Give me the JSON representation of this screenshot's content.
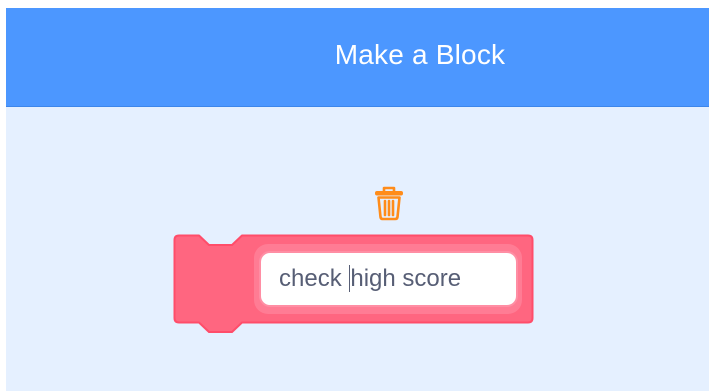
{
  "dialog": {
    "title": "Make a Block"
  },
  "block_editor": {
    "delete_icon": "trash-icon",
    "block_color": "#ff6680",
    "block_border_color": "#ff4d6a",
    "name_input": {
      "text_before_caret": "check ",
      "text_after_caret": "high score"
    }
  },
  "colors": {
    "header": "#4c97ff",
    "body": "#e5f0ff",
    "delete_icon": "#ff8c1a"
  }
}
